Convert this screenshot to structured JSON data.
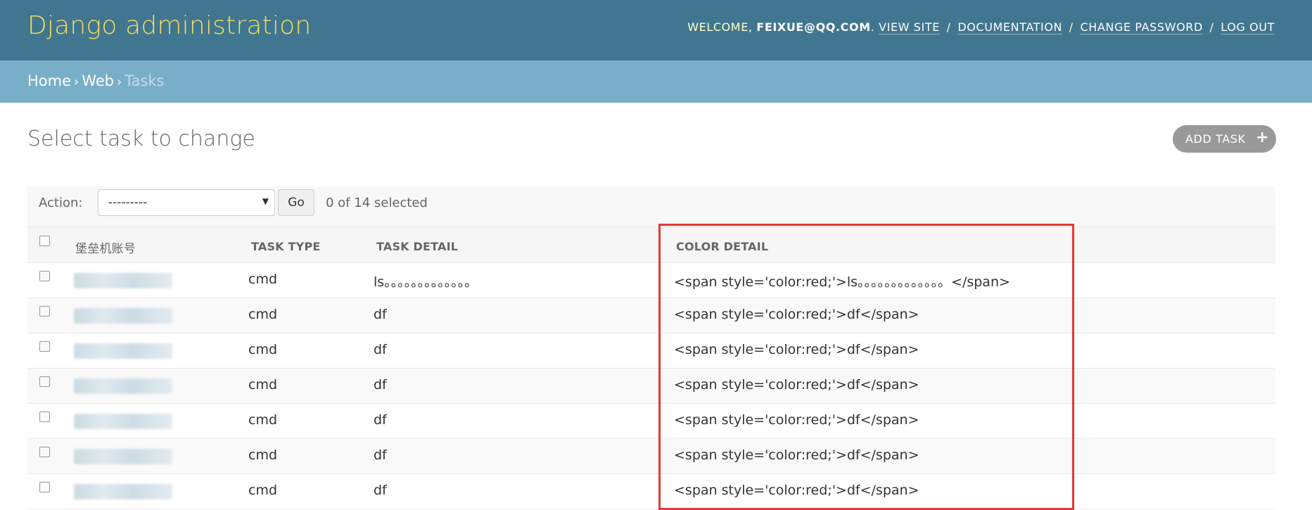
{
  "header": {
    "branding": "Django administration",
    "welcome_prefix": "WELCOME, ",
    "username": "FEIXUE@QQ.COM",
    "welcome_suffix": ".",
    "links": {
      "view_site": "VIEW SITE",
      "documentation": "DOCUMENTATION",
      "change_password": "CHANGE PASSWORD",
      "log_out": "LOG OUT"
    },
    "separator": "/"
  },
  "breadcrumbs": {
    "home": "Home",
    "app": "Web",
    "current": "Tasks",
    "separator": "›"
  },
  "page": {
    "title": "Select task to change",
    "add_button": "ADD TASK",
    "add_icon": "+"
  },
  "actions": {
    "label": "Action:",
    "selected_value": "---------",
    "go_button": "Go",
    "counter": "0 of 14 selected"
  },
  "table": {
    "columns": {
      "account": "堡垒机账号",
      "task_type": "TASK TYPE",
      "task_detail": "TASK DETAIL",
      "color_detail": "COLOR DETAIL"
    },
    "rows": [
      {
        "task_type": "cmd",
        "task_detail": "ls。。。。。。。。。。。。。",
        "color_detail": "<span style='color:red;'>ls。。。。。。。。。。。。。</span>"
      },
      {
        "task_type": "cmd",
        "task_detail": "df",
        "color_detail": "<span style='color:red;'>df</span>"
      },
      {
        "task_type": "cmd",
        "task_detail": "df",
        "color_detail": "<span style='color:red;'>df</span>"
      },
      {
        "task_type": "cmd",
        "task_detail": "df",
        "color_detail": "<span style='color:red;'>df</span>"
      },
      {
        "task_type": "cmd",
        "task_detail": "df",
        "color_detail": "<span style='color:red;'>df</span>"
      },
      {
        "task_type": "cmd",
        "task_detail": "df",
        "color_detail": "<span style='color:red;'>df</span>"
      },
      {
        "task_type": "cmd",
        "task_detail": "df",
        "color_detail": "<span style='color:red;'>df</span>"
      }
    ]
  },
  "colors": {
    "header_bg": "#417690",
    "branding": "#f5dd5d",
    "breadcrumbs_bg": "#79aec8",
    "highlight": "#e53935"
  }
}
